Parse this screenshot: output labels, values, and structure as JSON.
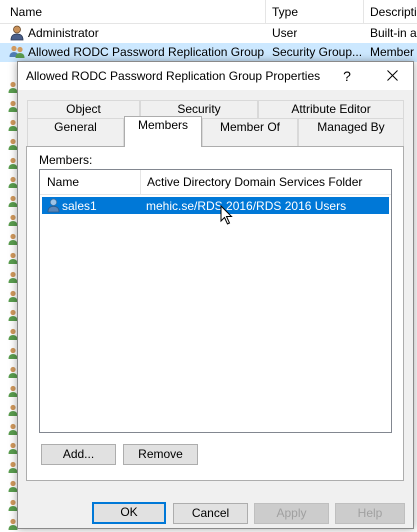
{
  "background": {
    "columns": [
      "Name",
      "Type",
      "Descripti"
    ],
    "rows": [
      {
        "name": "Administrator",
        "type": "User",
        "description": "Built-in a",
        "icon": "user-icon",
        "selected": false
      },
      {
        "name": "Allowed RODC Password Replication Group",
        "type": "Security Group...",
        "description": "Member",
        "icon": "group-icon",
        "selected": true
      }
    ]
  },
  "dialog": {
    "title": "Allowed RODC Password Replication Group Properties",
    "help_label": "?",
    "close_label": "✕",
    "tabs_back": [
      "Object",
      "Security",
      "Attribute Editor"
    ],
    "tabs_front": [
      "General",
      "Members",
      "Member Of",
      "Managed By"
    ],
    "active_tab": "Members",
    "members_label": "Members:",
    "list": {
      "columns": [
        "Name",
        "Active Directory Domain Services Folder"
      ],
      "rows": [
        {
          "name": "sales1",
          "folder": "mehic.se/RDS 2016/RDS 2016 Users",
          "icon": "user-icon",
          "selected": true
        }
      ]
    },
    "add_label": "Add...",
    "remove_label": "Remove",
    "ok_label": "OK",
    "cancel_label": "Cancel",
    "apply_label": "Apply",
    "help_button_label": "Help"
  },
  "colors": {
    "selection": "#0078d7",
    "background_selection": "#cce8ff",
    "dialog_bg": "#f0f0f0"
  }
}
